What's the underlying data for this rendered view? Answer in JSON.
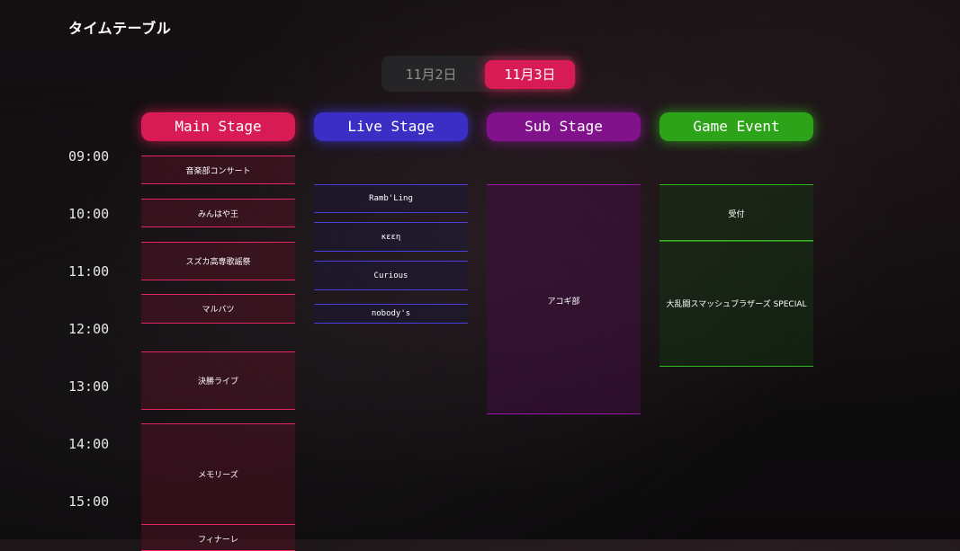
{
  "header": {
    "title": "タイムテーブル"
  },
  "dates": {
    "day1": "11月2日",
    "day2": "11月3日",
    "selected": "11月3日"
  },
  "stages": {
    "main": "Main Stage",
    "live": "Live Stage",
    "sub": "Sub Stage",
    "game": "Game Event"
  },
  "colors": {
    "main": "#d81b55",
    "live": "#3a2ec4",
    "sub": "#82118c",
    "game": "#2da31a"
  },
  "times": [
    "09:00",
    "10:00",
    "11:00",
    "12:00",
    "13:00",
    "14:00",
    "15:00"
  ],
  "events": {
    "main": [
      "音楽部コンサート",
      "みんはや王",
      "スズカ高専歌謡祭",
      "マルバツ",
      "決勝ライブ",
      "メモリーズ",
      "フィナーレ"
    ],
    "live": [
      "Ramb'Ling",
      "κεεη",
      "Curious",
      "nobody's"
    ],
    "sub": [
      "アコギ部"
    ],
    "game": [
      "受付",
      "大乱闘スマッシュブラザーズ SPECIAL"
    ]
  }
}
